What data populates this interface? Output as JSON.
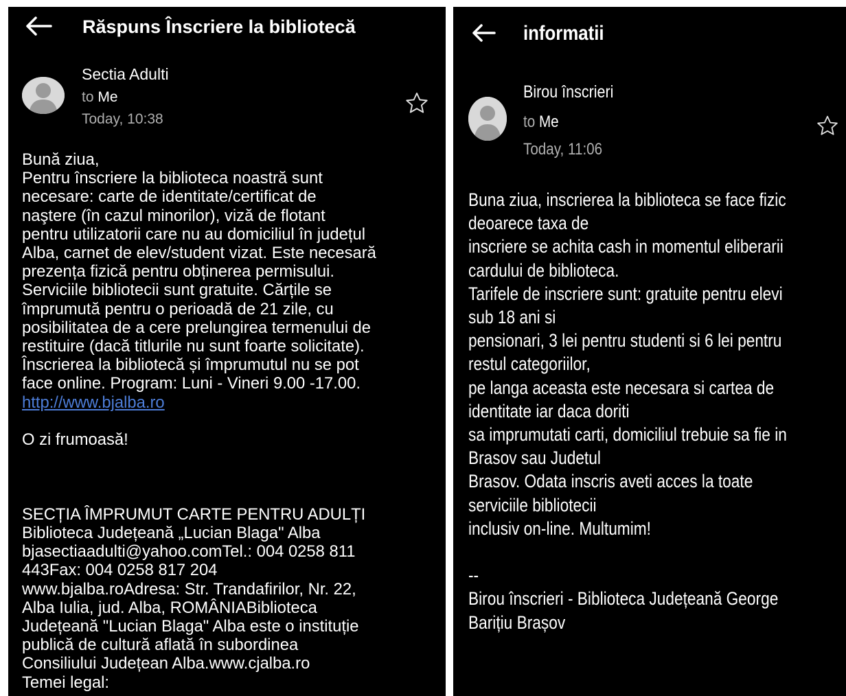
{
  "left_email": {
    "back_icon": "arrow-left-icon",
    "subject": "Răspuns Înscriere la bibliotecă",
    "sender": "Sectia Adulti",
    "to_label": "to",
    "to_value": "Me",
    "date": "Today, 10:38",
    "star_icon": "star-outline-icon",
    "body_lines": [
      "Bună ziua,",
      "Pentru înscriere la biblioteca noastră sunt",
      "necesare: carte de identitate/certificat de",
      "naştere (în cazul minorilor), viză de flotant",
      "pentru utilizatorii care nu au domiciliul în județul",
      "Alba, carnet de elev/student vizat. Este necesară",
      "prezența fizică pentru obținerea permisului.",
      "Serviciile bibliotecii sunt gratuite. Cărțile se",
      "împrumută pentru o perioadă de 21 zile, cu",
      "posibilitatea de a cere prelungirea termenului de",
      "restituire (dacă titlurile nu sunt foarte solicitate).",
      "Înscrierea la bibliotecă și împrumutul nu se pot",
      "face online. Program: Luni - Vineri 9.00 -17.00."
    ],
    "link": "http://www.bjalba.ro",
    "closing": "O zi frumoasă!",
    "signature_lines": [
      "SECȚIA ÎMPRUMUT CARTE PENTRU ADULȚI",
      "Biblioteca Județeană „Lucian Blaga\" Alba",
      "bjasectiaadulti@yahoo.comTel.: 004 0258 811",
      "443Fax: 004 0258 817 204",
      "www.bjalba.roAdresa: Str. Trandafirilor, Nr. 22,",
      "Alba Iulia, jud. Alba, ROMÂNIABiblioteca",
      "Județeană \"Lucian Blaga\" Alba este o instituție",
      "publică de cultură aflată în subordinea",
      "Consiliului Județean Alba.www.cjalba.ro",
      "Temei legal:"
    ]
  },
  "right_email": {
    "back_icon": "arrow-left-icon",
    "subject": "informatii",
    "sender": "Birou înscrieri",
    "to_label": "to",
    "to_value": "Me",
    "date": "Today, 11:06",
    "star_icon": "star-outline-icon",
    "body_lines": [
      "Buna ziua, inscrierea la biblioteca se face fizic",
      "deoarece taxa de",
      "inscriere se achita cash in momentul eliberarii",
      "cardului de biblioteca.",
      "Tarifele de inscriere sunt: gratuite pentru elevi",
      "sub 18 ani si",
      "pensionari, 3 lei pentru studenti si 6 lei pentru",
      "restul categoriilor,",
      "pe langa aceasta este necesara si cartea de",
      "identitate iar daca doriti",
      "sa imprumutati carti, domiciliul trebuie sa fie in",
      "Brasov sau Judetul",
      "Brasov. Odata inscris aveti acces la toate",
      "serviciile bibliotecii",
      "inclusiv on-line. Multumim!"
    ],
    "sig_separator": "--",
    "signature_lines": [
      "Birou înscrieri - Biblioteca Județeană George",
      "Barițiu Brașov"
    ]
  },
  "colors": {
    "background": "#000000",
    "text": "#ffffff",
    "secondary_text": "#b0b0b0",
    "link": "#4d7dd8",
    "avatar": "#d9d9d9"
  }
}
